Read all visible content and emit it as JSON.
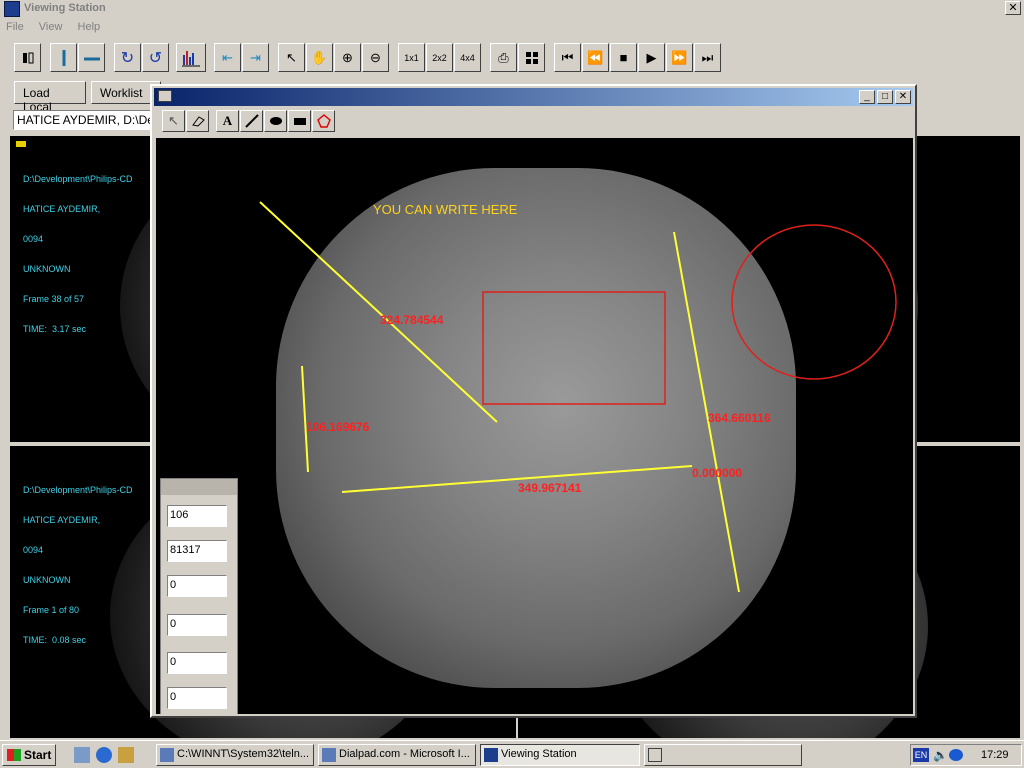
{
  "app": {
    "title": "Viewing Station",
    "close_glyph": "✕"
  },
  "menu": [
    "File",
    "View",
    "Help"
  ],
  "toolbar": {
    "icons": [
      "panel-toggle-icon",
      "ruler-vertical-icon",
      "ruler-horizontal-icon",
      "rotate-cw-icon",
      "rotate-ccw-icon",
      "histogram-icon",
      "previous-series-icon",
      "next-series-icon",
      "pointer-icon",
      "pan-hand-icon",
      "zoom-in-icon",
      "zoom-out-icon"
    ],
    "layouts": [
      "1x1",
      "2x2",
      "4x4"
    ],
    "actions": [
      "print-icon",
      "grid-icon",
      "first-frame-icon",
      "prev-frame-icon",
      "stop-icon",
      "play-icon",
      "next-frame-icon",
      "last-frame-icon"
    ]
  },
  "tabs": {
    "load_local": "Load Local",
    "worklist": "Worklist"
  },
  "patient_field": "HATICE AYDEMIR,  D:\\De",
  "panes": {
    "top": {
      "lines": [
        "D:\\Development\\Philips-CD",
        "HATICE AYDEMIR,",
        "0094",
        "UNKNOWN",
        "Frame 38 of 57",
        "TIME:  3.17 sec"
      ]
    },
    "bottom": {
      "lines": [
        "D:\\Development\\Philips-CD",
        "HATICE AYDEMIR,",
        "0094",
        "UNKNOWN",
        "Frame 1 of 80",
        "TIME:  0.08 sec"
      ]
    }
  },
  "dialog": {
    "tools": [
      "select-arrow-icon",
      "eraser-icon",
      "text-tool-icon",
      "line-tool-icon",
      "ellipse-tool-icon",
      "rectangle-tool-icon",
      "polygon-tool-icon"
    ],
    "text_tool": "A",
    "annotation_text": "YOU CAN WRITE HERE",
    "measurements": [
      "324.784544",
      "106.169676",
      "349.967141",
      "364.660116",
      "0.000000"
    ],
    "colors": {
      "line": "#ffff33",
      "shape": "#e0201a",
      "measure": "#ff2020",
      "annotation": "#ffd21e"
    }
  },
  "side_panel": {
    "fields": [
      "106",
      "81317",
      "0",
      "0",
      "0",
      "0"
    ]
  },
  "taskbar": {
    "start": "Start",
    "tasks": [
      "C:\\WINNT\\System32\\teln...",
      "Dialpad.com - Microsoft I...",
      "Viewing Station",
      ""
    ],
    "lang": "EN",
    "clock": "17:29"
  }
}
